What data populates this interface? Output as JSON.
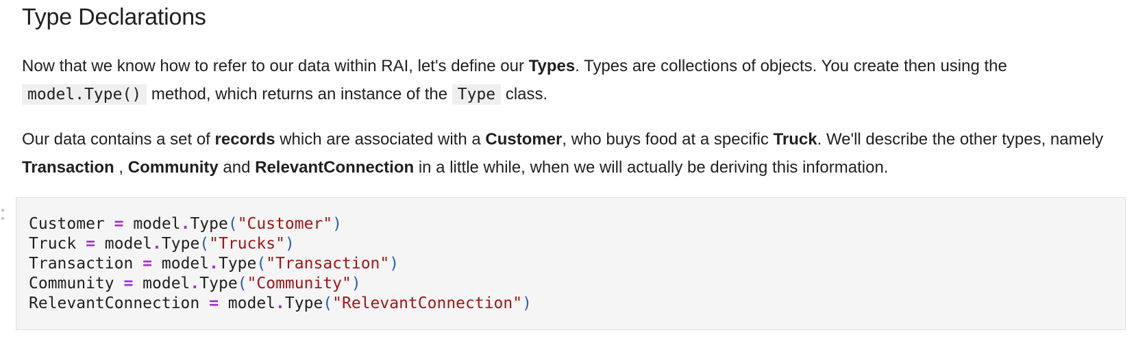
{
  "markdown": {
    "heading": "Type Declarations",
    "para1": {
      "t1": "Now that we know how to refer to our data within RAI, let's define our ",
      "b1": "Types",
      "t2": ". Types are collections of objects. You create then using the ",
      "code1": "model.Type()",
      "t3": " method, which returns an instance of the ",
      "code2": "Type",
      "t4": " class."
    },
    "para2": {
      "t1": "Our data contains a set of ",
      "b1": "records",
      "t2": " which are associated with a ",
      "b2": "Customer",
      "t3": ", who buys food at a specific ",
      "b3": "Truck",
      "t4": ". We'll describe the other types, namely ",
      "b4": "Transaction",
      "t5": " , ",
      "b5": "Community",
      "t6": " and ",
      "b6": "RelevantConnection",
      "t7": " in a little while, when we will actually be deriving this information."
    }
  },
  "code_cell": {
    "lines": [
      {
        "var": "Customer",
        "eq": " = ",
        "obj": "model",
        "dot": ".",
        "fn": "Type",
        "open": "(",
        "arg": "\"Customer\"",
        "close": ")"
      },
      {
        "var": "Truck",
        "eq": " = ",
        "obj": "model",
        "dot": ".",
        "fn": "Type",
        "open": "(",
        "arg": "\"Trucks\"",
        "close": ")"
      },
      {
        "var": "Transaction",
        "eq": " = ",
        "obj": "model",
        "dot": ".",
        "fn": "Type",
        "open": "(",
        "arg": "\"Transaction\"",
        "close": ")"
      },
      {
        "var": "Community",
        "eq": " = ",
        "obj": "model",
        "dot": ".",
        "fn": "Type",
        "open": "(",
        "arg": "\"Community\"",
        "close": ")"
      },
      {
        "var": "RelevantConnection",
        "eq": " = ",
        "obj": "model",
        "dot": ".",
        "fn": "Type",
        "open": "(",
        "arg": "\"RelevantConnection\"",
        "close": ")"
      }
    ]
  },
  "icons": {
    "drag_handle": "drag-handle-icon"
  },
  "colors": {
    "code_background": "#f5f5f5",
    "operator": "#a626d6",
    "paren": "#2a5db0",
    "string": "#a31515",
    "inline_code_background": "#efefef"
  }
}
